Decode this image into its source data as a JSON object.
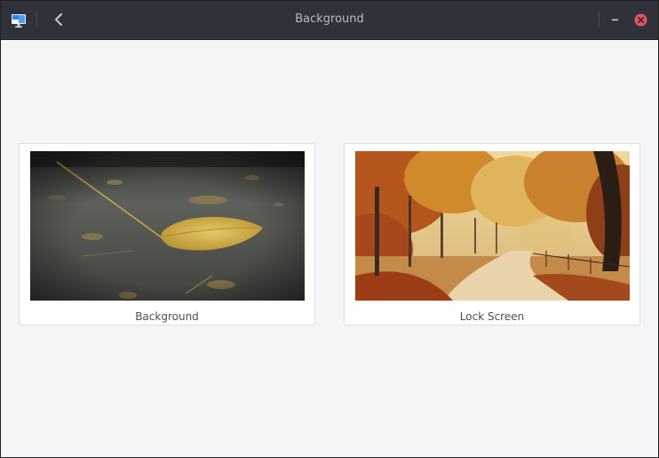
{
  "window": {
    "title": "Background",
    "app_icon": "monitor-icon",
    "back_icon": "chevron-left-icon",
    "minimize_icon": "minimize-icon",
    "close_icon": "close-icon",
    "colors": {
      "titlebar": "#2f323a",
      "content_bg": "#f4f5f7",
      "close_red": "#e0545e"
    }
  },
  "cards": [
    {
      "label": "Background",
      "image": "autumn-leaf-on-asphalt"
    },
    {
      "label": "Lock Screen",
      "image": "autumn-park-path"
    }
  ]
}
